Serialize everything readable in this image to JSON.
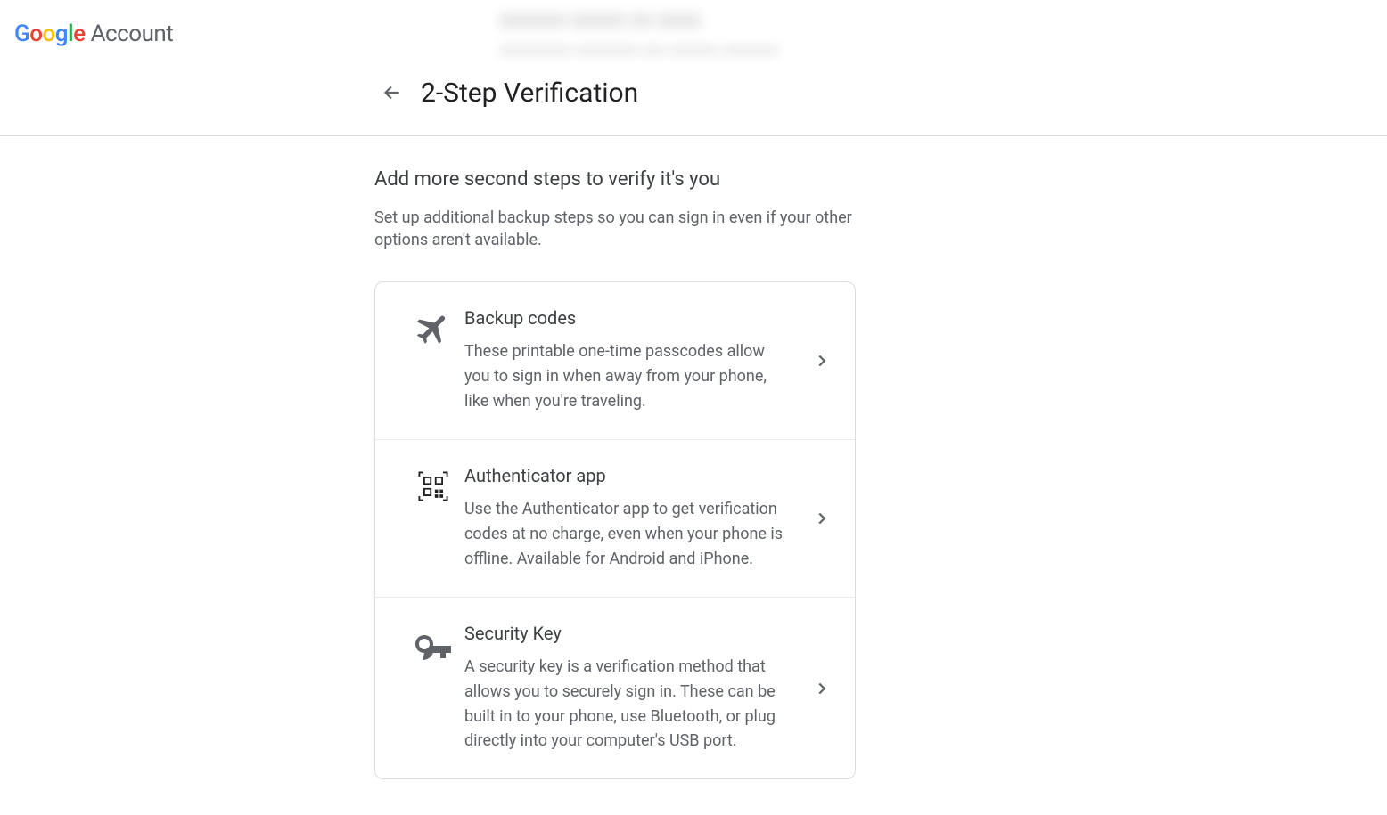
{
  "brand": {
    "name": "Google",
    "product": "Account"
  },
  "header": {
    "title": "2-Step Verification"
  },
  "section": {
    "heading": "Add more second steps to verify it's you",
    "sub": "Set up additional backup steps so you can sign in even if your other options aren't available."
  },
  "options": [
    {
      "title": "Backup codes",
      "desc": "These printable one-time passcodes allow you to sign in when away from your phone, like when you're traveling."
    },
    {
      "title": "Authenticator app",
      "desc": "Use the Authenticator app to get verification codes at no charge, even when your phone is offline. Available for Android and iPhone."
    },
    {
      "title": "Security Key",
      "desc": "A security key is a verification method that allows you to securely sign in. These can be built in to your phone, use Bluetooth, or plug directly into your computer's USB port."
    }
  ]
}
